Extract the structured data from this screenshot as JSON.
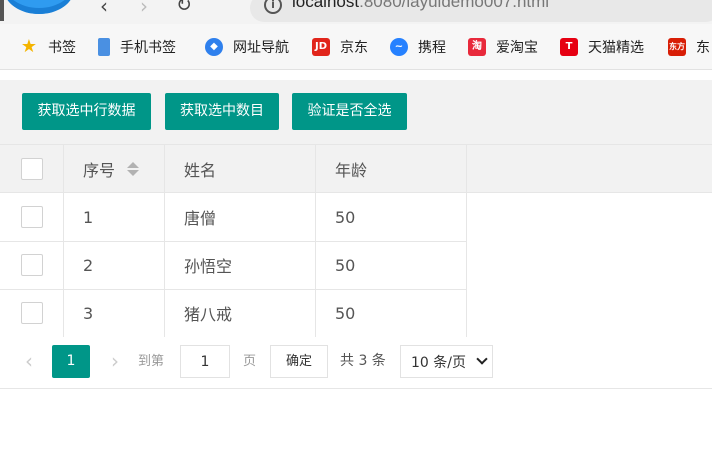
{
  "browser": {
    "url_host": "localhost",
    "url_rest": ":8080/layuidemo007.html",
    "bookmarks": [
      {
        "label": "书签",
        "icon": "star-icon",
        "color": "#f4b400"
      },
      {
        "label": "手机书签",
        "icon": "phone-icon",
        "color": "#4a90e2"
      },
      {
        "label": "网址导航",
        "icon": "compass-icon",
        "color": "#2f80ed"
      },
      {
        "label": "京东",
        "icon": "jd-icon",
        "color": "#e1251b"
      },
      {
        "label": "携程",
        "icon": "ctrip-icon",
        "color": "#2681ff"
      },
      {
        "label": "爱淘宝",
        "icon": "taobao-icon",
        "color": "#ff5000"
      },
      {
        "label": "天猫精选",
        "icon": "tmall-icon",
        "color": "#e60012"
      },
      {
        "label": "东",
        "icon": "dongfang-icon",
        "color": "#d81e06"
      }
    ]
  },
  "toolbar": {
    "btn_get_rows": "获取选中行数据",
    "btn_get_count": "获取选中数目",
    "btn_check_all": "验证是否全选"
  },
  "table": {
    "headers": [
      "序号",
      "姓名",
      "年龄"
    ],
    "rows": [
      {
        "id": "1",
        "name": "唐僧",
        "age": "50"
      },
      {
        "id": "2",
        "name": "孙悟空",
        "age": "50"
      },
      {
        "id": "3",
        "name": "猪八戒",
        "age": "50"
      }
    ]
  },
  "pager": {
    "prev": "‹",
    "current": "1",
    "next": "›",
    "skip_label": "到第",
    "page_input": "1",
    "page_unit": "页",
    "go_label": "确定",
    "count_label": "共 3 条",
    "limit_label": "10 条/页"
  },
  "colors": {
    "accent": "#009688",
    "header_bg": "#f2f2f2",
    "border": "#e6e6e6"
  }
}
